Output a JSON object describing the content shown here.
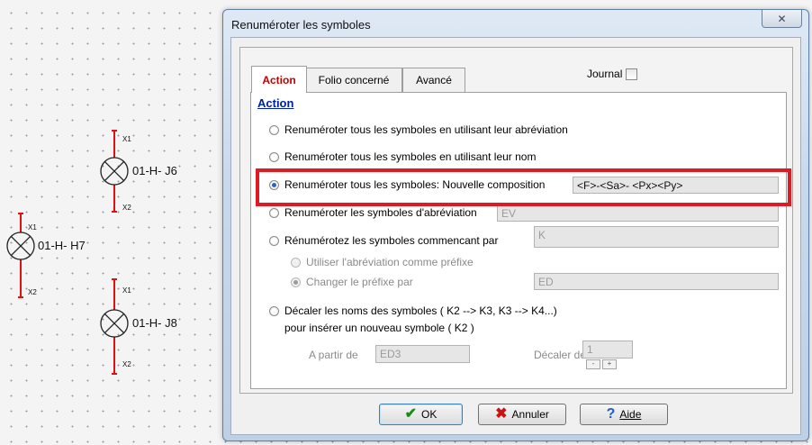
{
  "canvas": {
    "symbols": [
      {
        "label": "01-H- J6",
        "pin_top": "X1",
        "pin_bottom": "X2"
      },
      {
        "label": "01-H- H7",
        "pin_top": "X1",
        "pin_bottom": "X2"
      },
      {
        "label": "01-H- J8",
        "pin_top": "X1",
        "pin_bottom": "X2"
      }
    ]
  },
  "dialog": {
    "title": "Renuméroter les symboles",
    "close_glyph": "✕",
    "tabs": [
      {
        "label": "Action",
        "active": true
      },
      {
        "label": "Folio concerné",
        "active": false
      },
      {
        "label": "Avancé",
        "active": false
      }
    ],
    "journal_label": "Journal",
    "journal_checked": false,
    "section_title": "Action",
    "options": [
      {
        "label": "Renuméroter tous les symboles en utilisant leur abréviation",
        "selected": false
      },
      {
        "label": "Renuméroter tous les symboles en utilisant leur nom",
        "selected": false
      },
      {
        "label": "Renuméroter tous les symboles: Nouvelle composition",
        "selected": true,
        "value": "<F>-<Sa>- <Px><Py>"
      },
      {
        "label": "Renuméroter les symboles d'abréviation",
        "selected": false,
        "value": "EV"
      },
      {
        "label": "Rénumérotez les symboles commencant par",
        "selected": false,
        "value": "K"
      },
      {
        "label": "Décaler les noms des symboles ( K2 --> K3, K3 --> K4...)",
        "selected": false,
        "sub": "pour insérer un nouveau symbole ( K2 )"
      }
    ],
    "suboptions": [
      {
        "label": "Utiliser l'abréviation comme préfixe",
        "selected": false
      },
      {
        "label": "Changer le préfixe par",
        "selected": true,
        "value": "ED"
      }
    ],
    "from_label": "A partir de",
    "from_value": "ED3",
    "shift_label": "Décaler de:",
    "shift_value": "1",
    "stepper_minus": "-",
    "stepper_plus": "+",
    "buttons": {
      "ok": {
        "label": "OK",
        "icon": "check-icon"
      },
      "cancel": {
        "label": "Annuler",
        "icon": "x-icon"
      },
      "help": {
        "label": "Aide",
        "icon": "help-icon"
      }
    }
  },
  "colors": {
    "highlight": "#e01a22",
    "tab_active": "#c00000",
    "section_title": "#0020a0"
  }
}
